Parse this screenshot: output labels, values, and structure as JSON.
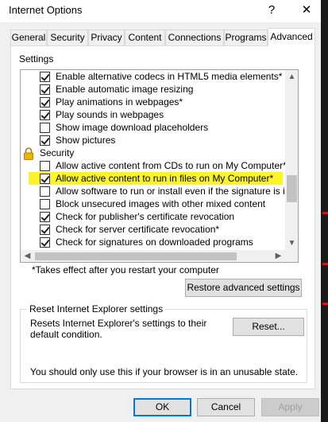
{
  "window": {
    "title": "Internet Options",
    "help_glyph": "?",
    "close_glyph": "✕"
  },
  "tabs": [
    {
      "label": "General"
    },
    {
      "label": "Security"
    },
    {
      "label": "Privacy"
    },
    {
      "label": "Content"
    },
    {
      "label": "Connections"
    },
    {
      "label": "Programs"
    },
    {
      "label": "Advanced",
      "active": true
    }
  ],
  "settings": {
    "title": "Settings",
    "rows": [
      {
        "label": "Enable alternative codecs in HTML5 media elements*",
        "checked": true
      },
      {
        "label": "Enable automatic image resizing",
        "checked": true
      },
      {
        "label": "Play animations in webpages*",
        "checked": true
      },
      {
        "label": "Play sounds in webpages",
        "checked": true
      },
      {
        "label": "Show image download placeholders",
        "checked": false
      },
      {
        "label": "Show pictures",
        "checked": true
      },
      {
        "label": "Security",
        "category": true,
        "icon": "lock-icon"
      },
      {
        "label": "Allow active content from CDs to run on My Computer*",
        "checked": false
      },
      {
        "label": "Allow active content to run in files on My Computer*",
        "checked": true,
        "highlighted": true
      },
      {
        "label": "Allow software to run or install even if the signature is invalid",
        "checked": false
      },
      {
        "label": "Block unsecured images with other mixed content",
        "checked": false
      },
      {
        "label": "Check for publisher's certificate revocation",
        "checked": true
      },
      {
        "label": "Check for server certificate revocation*",
        "checked": true
      },
      {
        "label": "Check for signatures on downloaded programs",
        "checked": true
      }
    ],
    "vscroll": {
      "up": "▲",
      "down": "▼"
    },
    "hscroll": {
      "left": "◀",
      "right": "▶"
    },
    "restart_note": "*Takes effect after you restart your computer",
    "restore_button": "Restore advanced settings"
  },
  "reset": {
    "title": "Reset Internet Explorer settings",
    "description": "Resets Internet Explorer's settings to their default condition.",
    "button": "Reset...",
    "warning": "You should only use this if your browser is in an unusable state."
  },
  "footer": {
    "ok": "OK",
    "cancel": "Cancel",
    "apply": "Apply"
  },
  "colors": {
    "highlight": "#fbf42a",
    "focus_border": "#0078d7",
    "lock": "#d9a400"
  }
}
